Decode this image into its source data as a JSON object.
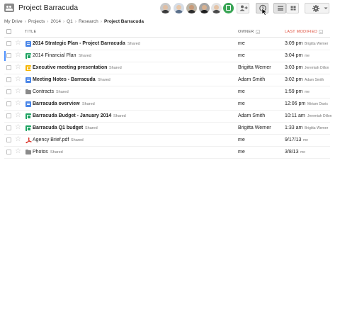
{
  "header": {
    "title": "Project Barracuda",
    "avatars": [
      {
        "name": "collaborator-avatar-1",
        "skin": "#e0bfa4",
        "shirt": "#3a3a3a",
        "bg": "#c9c9c9"
      },
      {
        "name": "collaborator-avatar-2",
        "skin": "#e8c8aa",
        "shirt": "#5a6f8a",
        "bg": "#d6dde6"
      },
      {
        "name": "collaborator-avatar-3",
        "skin": "#c99a78",
        "shirt": "#2c2c2c",
        "bg": "#bdb6a8"
      },
      {
        "name": "collaborator-avatar-4",
        "skin": "#d7b08f",
        "shirt": "#1e1e1e",
        "bg": "#a5a5a5"
      },
      {
        "name": "collaborator-avatar-5",
        "skin": "#e4c3a6",
        "shirt": "#4a4a4a",
        "bg": "#e3e3e3"
      }
    ],
    "accent_color": "#3aa556"
  },
  "breadcrumb": {
    "items": [
      "My Drive",
      "Projects",
      "2014",
      "Q1",
      "Research"
    ],
    "current": "Project Barracuda",
    "separator": "›"
  },
  "columns": {
    "title": "TITLE",
    "owner": "OWNER",
    "last_modified": "LAST MODIFIED",
    "sort_color": "#dd4b39"
  },
  "files": [
    {
      "icon": "doc",
      "name": "2014 Strategic Plan - Project Barracuda",
      "bold": true,
      "shared": "Shared",
      "owner": "me",
      "time": "3:09 pm",
      "by": "Brigitta Werner"
    },
    {
      "icon": "sheet",
      "name": "2014 Financial Plan",
      "bold": false,
      "shared": "Shared",
      "owner": "me",
      "time": "3:04 pm",
      "by": "me"
    },
    {
      "icon": "slide",
      "name": "Executive meeting presentation",
      "bold": true,
      "shared": "Shared",
      "owner": "Brigitta Werner",
      "time": "3:03 pm",
      "by": "Jeremiah Dillon"
    },
    {
      "icon": "doc",
      "name": "Meeting Notes - Barracuda",
      "bold": true,
      "shared": "Shared",
      "owner": "Adam Smith",
      "time": "3:02 pm",
      "by": "Adam Smith"
    },
    {
      "icon": "shared-folder",
      "name": "Contracts",
      "bold": false,
      "shared": "Shared",
      "owner": "me",
      "time": "1:59 pm",
      "by": "me"
    },
    {
      "icon": "doc",
      "name": "Barracuda overview",
      "bold": true,
      "shared": "Shared",
      "owner": "me",
      "time": "12:06 pm",
      "by": "Miriam Davis"
    },
    {
      "icon": "sheet",
      "name": "Barracuda Budget - January 2014",
      "bold": true,
      "shared": "Shared",
      "owner": "Adam Smith",
      "time": "10:11 am",
      "by": "Jeremiah Dillon"
    },
    {
      "icon": "sheet",
      "name": "Barracuda Q1 budget",
      "bold": true,
      "shared": "Shared",
      "owner": "Brigitta Werner",
      "time": "1:33 am",
      "by": "Brigitta Werner"
    },
    {
      "icon": "pdf",
      "name": "Agency Brief.pdf",
      "bold": false,
      "shared": "Shared",
      "owner": "me",
      "time": "9/17/13",
      "by": "me"
    },
    {
      "icon": "shared-folder",
      "name": "Photos",
      "bold": false,
      "shared": "Shared",
      "owner": "me",
      "time": "3/8/13",
      "by": "me"
    }
  ]
}
